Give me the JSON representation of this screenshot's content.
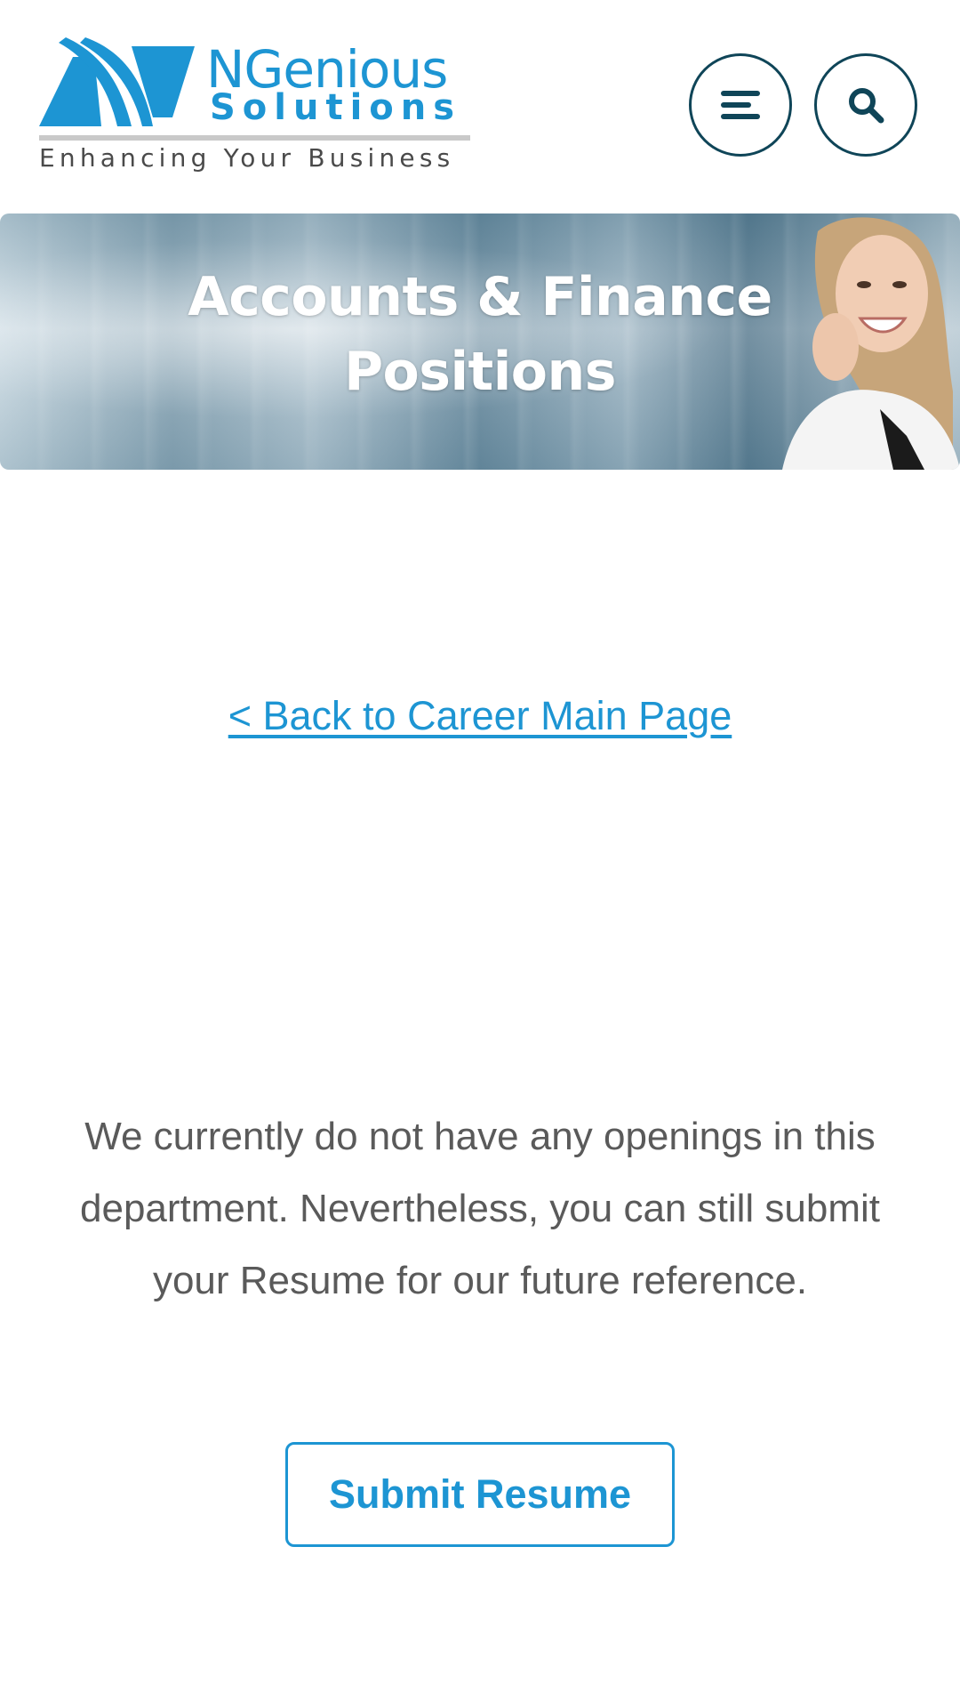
{
  "header": {
    "logo": {
      "name": "NGenious",
      "sub": "Solutions",
      "tagline": "Enhancing Your Business"
    },
    "menu_icon": "hamburger-menu-icon",
    "search_icon": "search-icon"
  },
  "banner": {
    "title": "Accounts & Finance Positions"
  },
  "content": {
    "back_link": "< Back to Career Main Page",
    "message": "We currently do not have any openings in this department. Nevertheless, you can still submit your Resume for our future reference.",
    "submit_button": "Submit Resume"
  },
  "colors": {
    "brand_blue": "#1d95d3",
    "dark_teal": "#0f4558",
    "body_text": "#5a5a5a"
  }
}
